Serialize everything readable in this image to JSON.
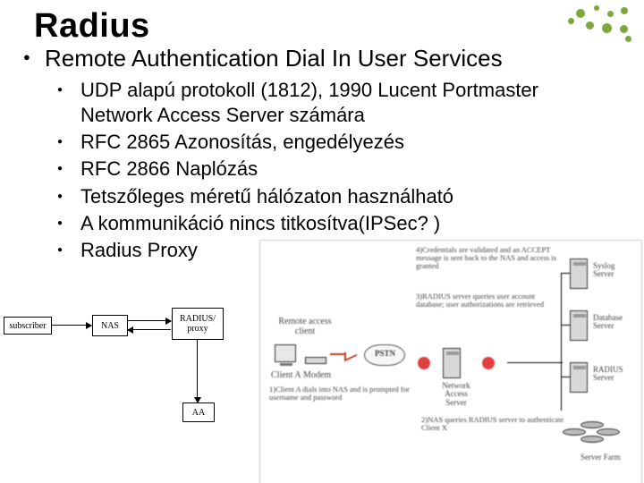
{
  "title": "Radius",
  "heading": "Remote Authentication Dial In User Services",
  "bullets": [
    "UDP alapú protokoll (1812), 1990 Lucent Portmaster Network Access Server számára",
    "RFC 2865 Azonosítás, engedélyezés",
    "RFC 2866  Naplózás",
    "Tetszőleges méretű hálózaton használható",
    "A kommunikáció nincs titkosítva(IPSec? )",
    "Radius Proxy"
  ],
  "diagLeft": {
    "subscriber": "subscriber",
    "nas": "NAS",
    "radius": "RADIUS/\nproxy",
    "aa": "AA"
  },
  "diagRight": {
    "step4": "4)Credentials are validated and an ACCEPT message is sent back to the NAS and access is granted",
    "step3": "3)RADIUS server queries user account database; user authorizations are retrieved",
    "remoteClient": "Remote access\nclient",
    "clientA": "Client A",
    "modem": "Modem",
    "pstn": "PSTN",
    "step1": "1)Client A dials into NAS and is prompted for username and password",
    "nas": "Network\nAccess\nServer",
    "step2": "2)NAS queries RADIUS server to authenticate Client X",
    "syslog": "Syslog\nServer",
    "db": "Database\nServer",
    "radius": "RADIUS\nServer",
    "farm": "Server Farm"
  }
}
